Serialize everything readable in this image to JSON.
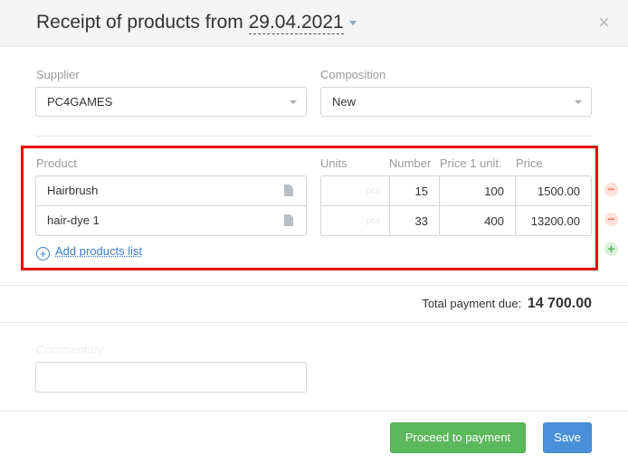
{
  "header": {
    "title_prefix": "Receipt of products from",
    "date": "29.04.2021",
    "close_glyph": "×"
  },
  "supplier": {
    "label": "Supplier",
    "value": "PC4GAMES"
  },
  "composition": {
    "label": "Composition",
    "value": "New"
  },
  "table": {
    "headers": {
      "product": "Product",
      "units": "Units",
      "number": "Number",
      "price_unit": "Price 1 unit.",
      "price": "Price"
    },
    "rows": [
      {
        "product": "Hairbrush",
        "units": "pcs",
        "number": "15",
        "price_unit": "100",
        "price": "1500.00"
      },
      {
        "product": "hair-dye 1",
        "units": "pcs",
        "number": "33",
        "price_unit": "400",
        "price": "13200.00"
      }
    ],
    "add_link": "Add products list",
    "add_icon": "+",
    "remove_icon": "−",
    "add_row_icon": "+"
  },
  "total": {
    "label": "Total payment due:",
    "amount": "14 700.00"
  },
  "comment": {
    "label": "Commentary"
  },
  "buttons": {
    "proceed": "Proceed to payment",
    "save": "Save"
  },
  "colors": {
    "highlight_border": "#e8000b",
    "primary_green": "#5cb85c",
    "primary_blue": "#4a90d9",
    "link": "#3b7fc4"
  }
}
